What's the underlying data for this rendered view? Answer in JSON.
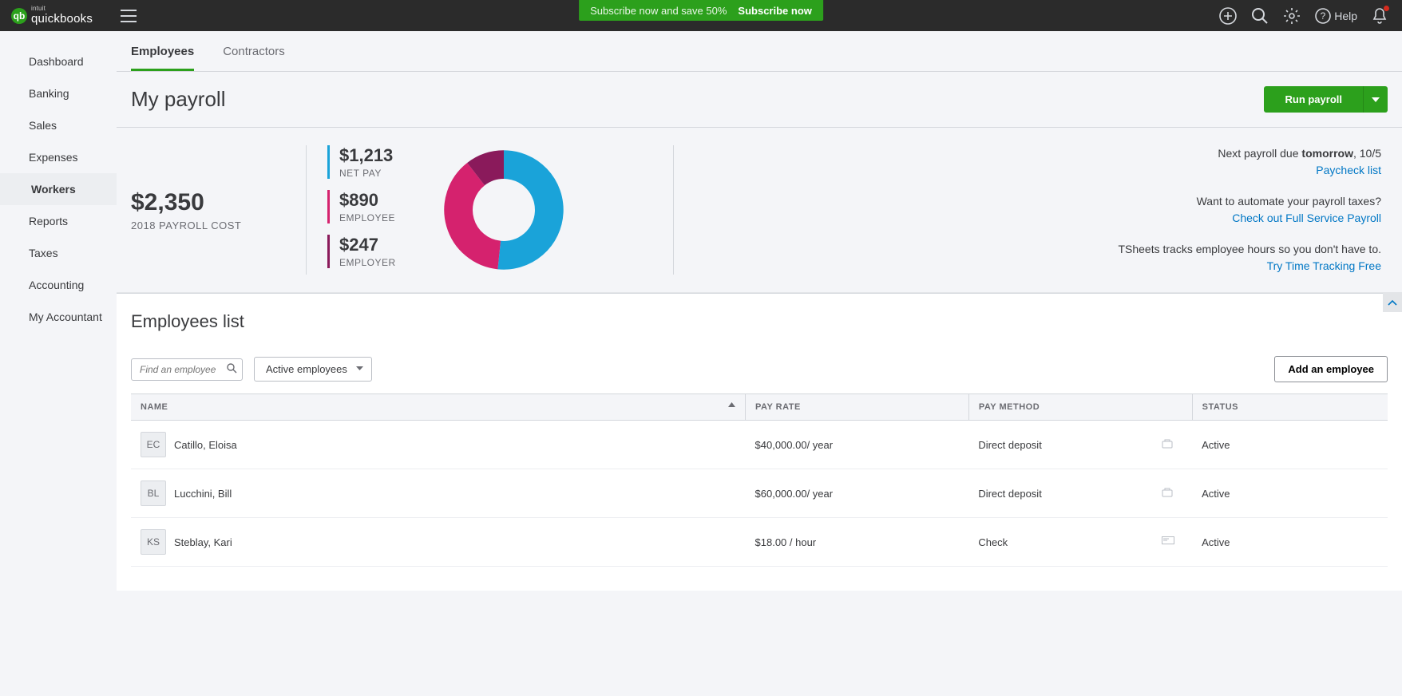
{
  "brand": {
    "name": "quickbooks",
    "parent": "intuit"
  },
  "banner": {
    "text": "Subscribe now and save 50%",
    "cta": "Subscribe now"
  },
  "top_icons": {
    "help_label": "Help"
  },
  "sidebar": {
    "items": [
      "Dashboard",
      "Banking",
      "Sales",
      "Expenses",
      "Workers",
      "Reports",
      "Taxes",
      "Accounting",
      "My Accountant"
    ],
    "active_index": 4
  },
  "tabs": {
    "items": [
      "Employees",
      "Contractors"
    ],
    "active_index": 0
  },
  "page": {
    "title": "My payroll",
    "run_label": "Run payroll"
  },
  "summary": {
    "total": {
      "amount": "$2,350",
      "caption": "2018 PAYROLL COST"
    },
    "breakdown": [
      {
        "value": "$1,213",
        "label": "NET PAY",
        "color": "#1aa3d9"
      },
      {
        "value": "$890",
        "label": "EMPLOYEE",
        "color": "#d5226e"
      },
      {
        "value": "$247",
        "label": "EMPLOYER",
        "color": "#8a1a5b"
      }
    ]
  },
  "chart_data": {
    "type": "pie",
    "series": [
      {
        "name": "NET PAY",
        "value": 1213,
        "color": "#1aa3d9"
      },
      {
        "name": "EMPLOYEE",
        "value": 890,
        "color": "#d5226e"
      },
      {
        "name": "EMPLOYER",
        "value": 247,
        "color": "#8a1a5b"
      }
    ],
    "total": 2350,
    "inner_radius_ratio": 0.55
  },
  "right_col": {
    "next_pre": "Next payroll due ",
    "next_bold": "tomorrow",
    "next_post": ", 10/5",
    "paycheck_link": "Paycheck list",
    "auto_text": "Want to automate your payroll taxes?",
    "auto_link": "Check out Full Service Payroll",
    "tsheets_text": "TSheets tracks employee hours so you don't have to.",
    "tsheets_link": "Try Time Tracking Free"
  },
  "employees": {
    "title": "Employees list",
    "search_placeholder": "Find an employee",
    "filter_label": "Active employees",
    "add_label": "Add an employee",
    "columns": [
      "NAME",
      "PAY RATE",
      "PAY METHOD",
      "STATUS"
    ],
    "rows": [
      {
        "initials": "EC",
        "name": "Catillo, Eloisa",
        "rate": "$40,000.00/ year",
        "method": "Direct deposit",
        "method_icon": "deposit",
        "status": "Active"
      },
      {
        "initials": "BL",
        "name": "Lucchini, Bill",
        "rate": "$60,000.00/ year",
        "method": "Direct deposit",
        "method_icon": "deposit",
        "status": "Active"
      },
      {
        "initials": "KS",
        "name": "Steblay, Kari",
        "rate": "$18.00 / hour",
        "method": "Check",
        "method_icon": "check",
        "status": "Active"
      }
    ]
  }
}
